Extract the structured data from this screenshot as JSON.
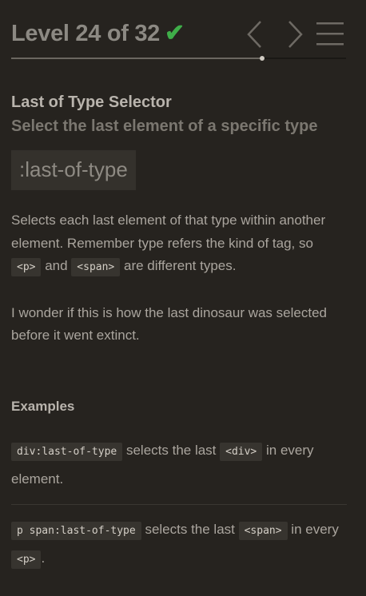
{
  "header": {
    "level_label": "Level 24 of 32",
    "check_icon": "✔",
    "progress_fraction": 0.75,
    "progress_fill_color": "#6b6760",
    "check_color": "#3fae49"
  },
  "nav": {
    "prev_icon": "chevron-left-icon",
    "next_icon": "chevron-right-icon",
    "menu_icon": "hamburger-menu-icon"
  },
  "selector": {
    "name": "Last of Type Selector",
    "title": "Select the last element of a specific type",
    "syntax": ":last-of-type"
  },
  "hint": {
    "part1": "Selects each last element of that type within another element. Remember type refers the kind of tag, so ",
    "code1": "<p>",
    "part2": " and ",
    "code2": "<span>",
    "part3": " are different types.",
    "extra": "I wonder if this is how the last dinosaur was selected before it went extinct."
  },
  "examples": {
    "title": "Examples",
    "items": [
      {
        "code": "div:last-of-type",
        "text1": " selects the last ",
        "code2": "<div>",
        "text2": " in every element."
      },
      {
        "code": "p span:last-of-type",
        "text1": " selects the last ",
        "code2": "<span>",
        "text2": " in every ",
        "code3": "<p>",
        "text3": "."
      }
    ]
  }
}
